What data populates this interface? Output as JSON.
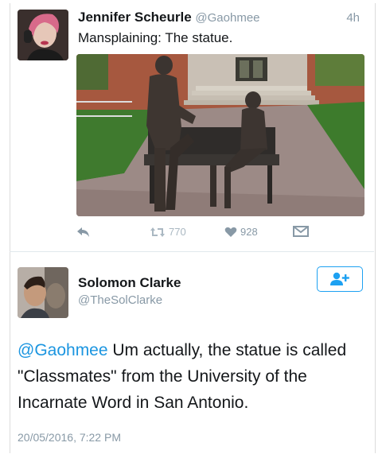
{
  "tweet1": {
    "author_name": "Jennifer Scheurle",
    "author_handle": "@Gaohmee",
    "time": "4h",
    "text": "Mansplaining: The statue.",
    "actions": {
      "reply_icon": "reply-icon",
      "retweet_icon": "retweet-icon",
      "retweet_count": "770",
      "like_icon": "heart-icon",
      "like_count": "928",
      "message_icon": "direct-message-icon"
    }
  },
  "tweet2": {
    "author_name": "Solomon Clarke",
    "author_handle": "@TheSolClarke",
    "follow_icon": "follow-user-icon",
    "mention": "@Gaohmee",
    "text": " Um actually, the statue is called \"Classmates\" from the University of the Incarnate Word in San Antonio.",
    "timestamp": "20/05/2016, 7:22 PM"
  },
  "colors": {
    "accent": "#1da1f2",
    "mention": "#1b95e0",
    "muted": "#8899a6",
    "like": "#aab8c2"
  }
}
